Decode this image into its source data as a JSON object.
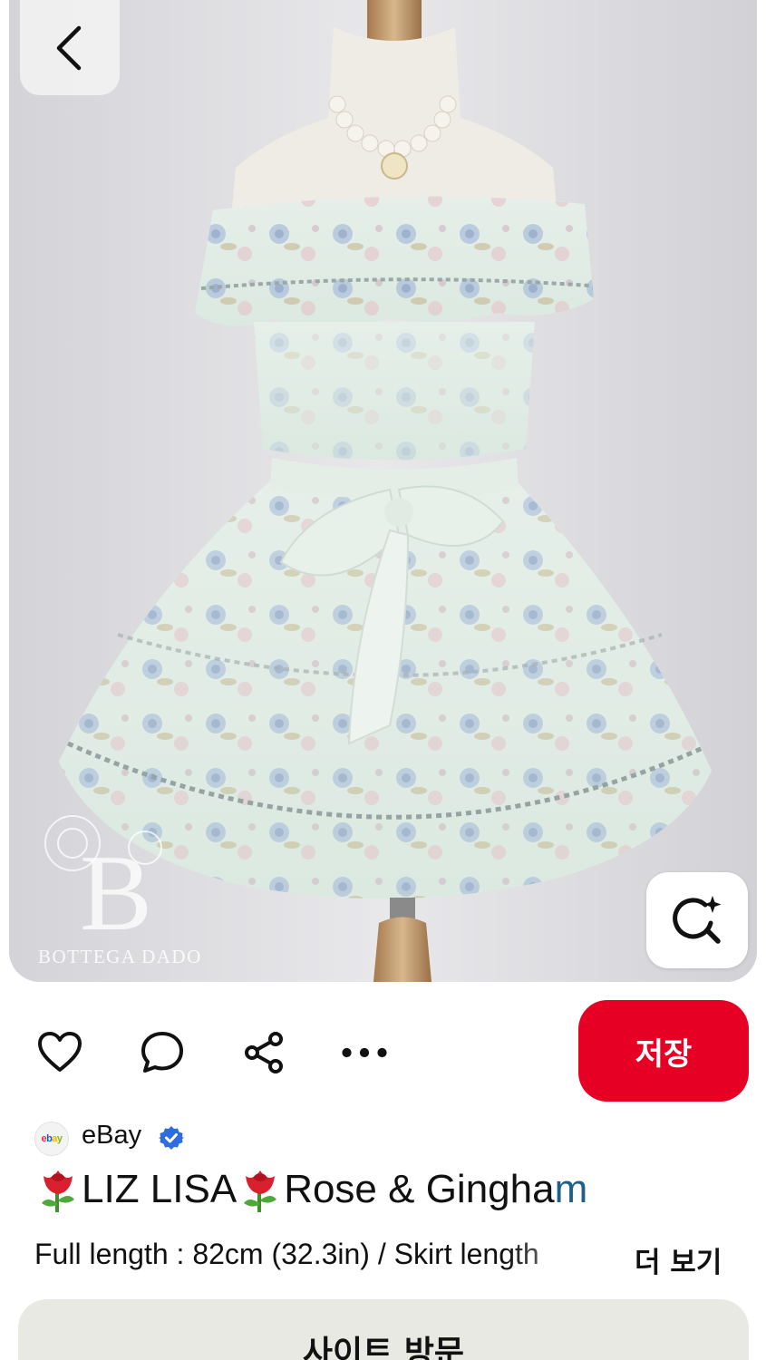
{
  "hero": {
    "watermark_text": "BOTTEGA DADO",
    "watermark_letter": "B"
  },
  "icons": {
    "back": "chevron-left-icon",
    "visual_search": "lens-sparkle-icon",
    "like": "heart-icon",
    "comment": "speech-bubble-icon",
    "share": "share-icon",
    "more": "ellipsis-icon"
  },
  "actions": {
    "save_label": "저장"
  },
  "source": {
    "logo_text": "ebay",
    "name": "eBay",
    "verified": true
  },
  "title": {
    "part1": "LIZ LISA",
    "part2": "Rose & Gingha",
    "part3": "m"
  },
  "description": {
    "text": "Full length : 82cm (32.3in) / Skirt length",
    "more_label": "더 보기"
  },
  "visit": {
    "label": "사이트 방문"
  },
  "colors": {
    "accent": "#e60023",
    "visit_bg": "#e9e9e4",
    "verified": "#2d6de0"
  }
}
